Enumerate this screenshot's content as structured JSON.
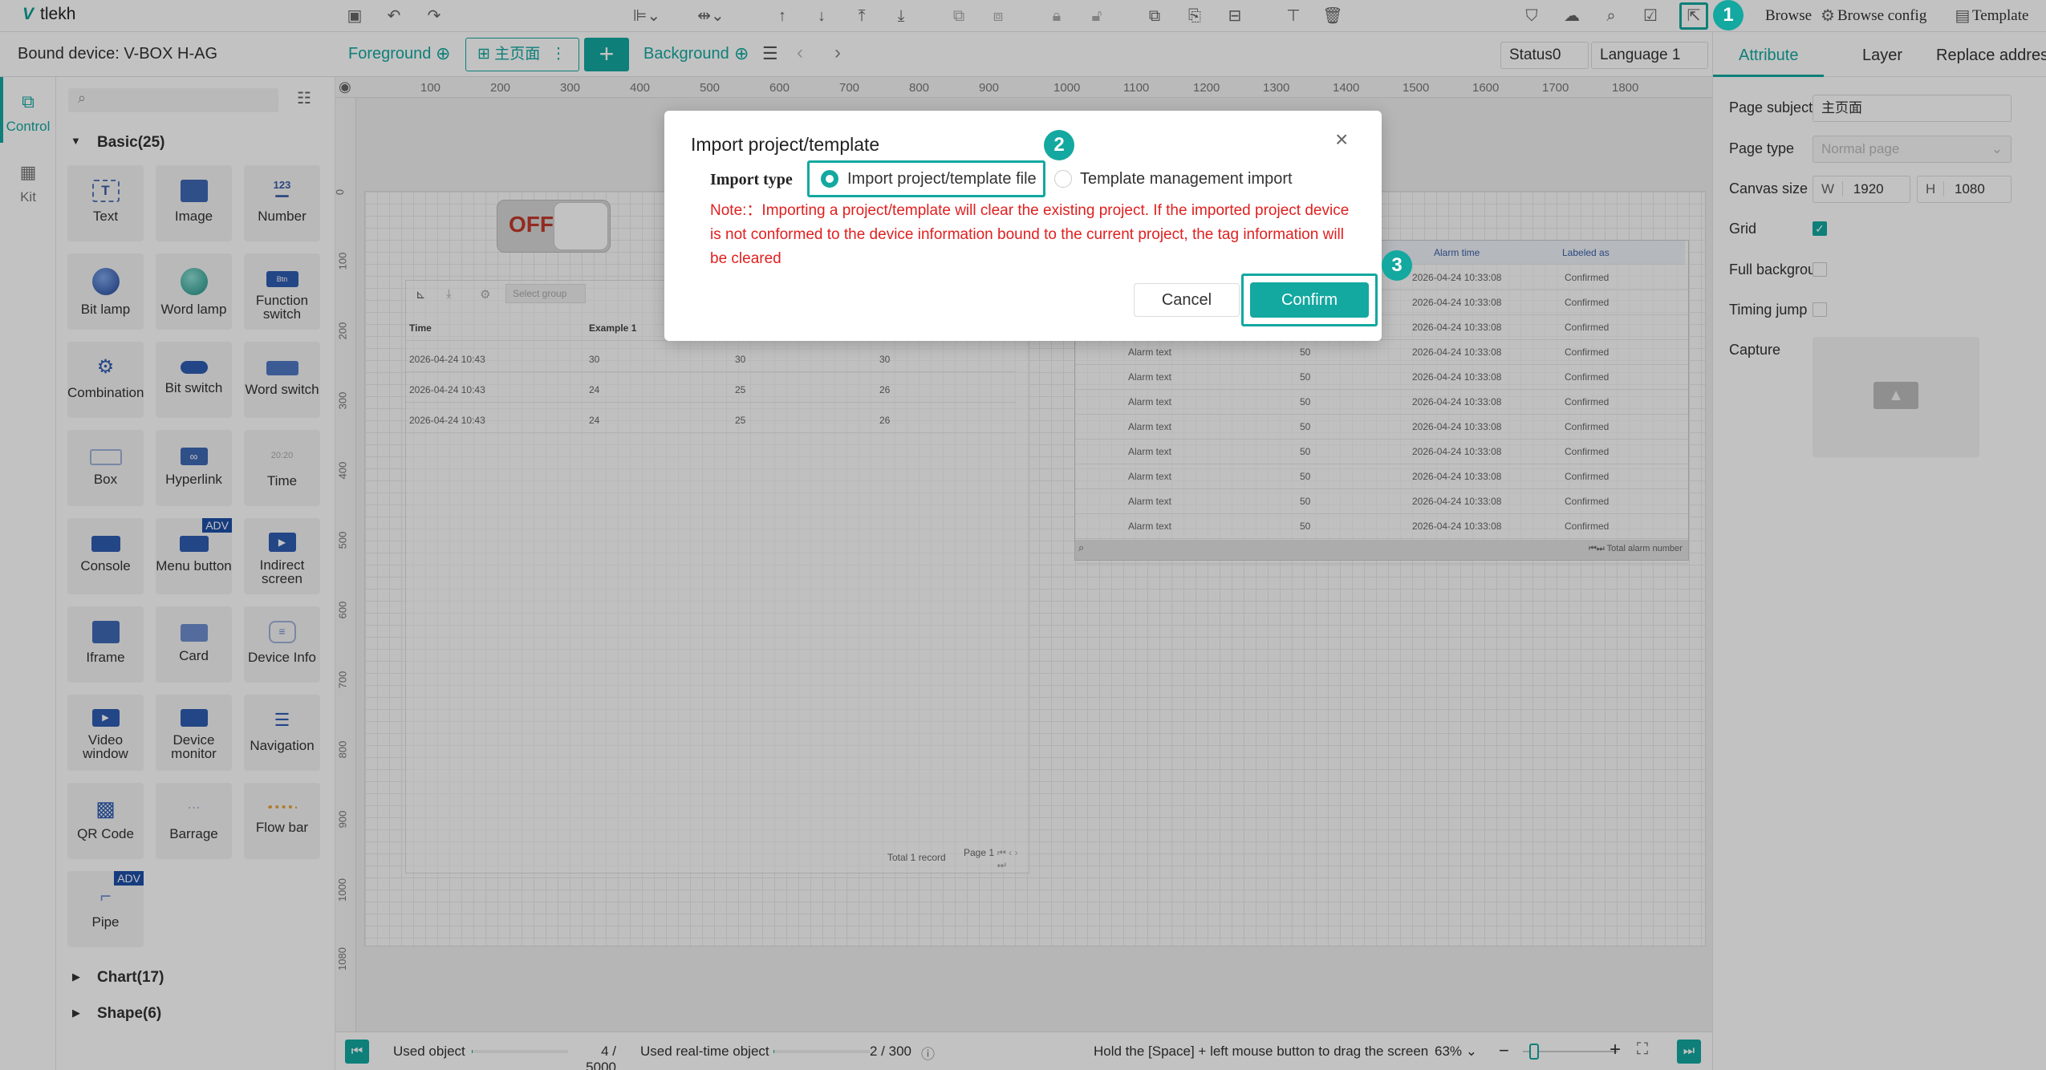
{
  "app": {
    "name": "tlekh"
  },
  "topbar": {
    "browse": "Browse",
    "browse_config": "Browse config",
    "template": "Template"
  },
  "bar2": {
    "device": "Bound device: V-BOX H-AG",
    "foreground": "Foreground",
    "page_tab": "主页面",
    "background": "Background",
    "status": "Status0",
    "language": "Language 1"
  },
  "rail": {
    "control": "Control",
    "kit": "Kit"
  },
  "panel": {
    "basic_header": "Basic(25)",
    "chart_header": "Chart(17)",
    "shape_header": "Shape(6)",
    "items": [
      "Text",
      "Image",
      "Number",
      "Bit lamp",
      "Word lamp",
      "Function switch",
      "Combination",
      "Bit switch",
      "Word switch",
      "Box",
      "Hyperlink",
      "Time",
      "Console",
      "Menu button",
      "Indirect screen",
      "Iframe",
      "Card",
      "Device Info",
      "Video window",
      "Device monitor",
      "Navigation",
      "QR Code",
      "Barrage",
      "Flow bar",
      "Pipe"
    ],
    "adv_badge": "ADV"
  },
  "ruler": {
    "h": [
      "100",
      "200",
      "300",
      "400",
      "500",
      "600",
      "700",
      "800",
      "900",
      "1000",
      "1100",
      "1200",
      "1300",
      "1400",
      "1500",
      "1600",
      "1700",
      "1800"
    ],
    "v": [
      "0",
      "100",
      "200",
      "300",
      "400",
      "500",
      "600",
      "700",
      "800",
      "900",
      "1000",
      "1080"
    ]
  },
  "canvas": {
    "toggle": "OFF",
    "left_table": {
      "select_group": "Select group",
      "headers": [
        "Time",
        "Example 1"
      ],
      "rows": [
        [
          "2026-04-24 10:43",
          "30",
          "30",
          "30"
        ],
        [
          "2026-04-24 10:43",
          "24",
          "25",
          "26"
        ],
        [
          "2026-04-24 10:43",
          "24",
          "25",
          "26"
        ]
      ],
      "footer_total": "Total 1 record",
      "footer_page": "Page 1"
    },
    "alarm_table": {
      "headers": [
        "Alarm time",
        "Labeled as"
      ],
      "col_text": "Alarm text",
      "col_value": "50",
      "col_time": "2026-04-24 10:33:08",
      "col_status": "Confirmed",
      "footer": "Total alarm number"
    }
  },
  "right_panel": {
    "tabs": [
      "Attribute",
      "Layer",
      "Replace address"
    ],
    "page_subject_label": "Page subject",
    "page_subject_value": "主页面",
    "page_type_label": "Page type",
    "page_type_value": "Normal page",
    "canvas_size_label": "Canvas size",
    "w_label": "W",
    "w_value": "1920",
    "h_label": "H",
    "h_value": "1080",
    "grid_label": "Grid",
    "full_bg_label": "Full backgroun",
    "timing_jump_label": "Timing jump",
    "capture_label": "Capture"
  },
  "status_bar": {
    "used_object_label": "Used object",
    "used_object_value": "4 / 5000",
    "used_object_fraction": 0.0008,
    "used_realtime_label": "Used real-time object",
    "used_realtime_value": "2 / 300",
    "used_realtime_fraction": 0.0067,
    "hint": "Hold the [Space] + left mouse button to drag the screen",
    "zoom": "63%"
  },
  "dialog": {
    "title": "Import project/template",
    "import_type_label": "Import type",
    "option1": "Import project/template file",
    "option2": "Template management import",
    "note": "Note:：Importing a project/template will clear the existing project. If the imported project device is not conformed to the device information bound to the current project, the tag information will be cleared",
    "cancel": "Cancel",
    "confirm": "Confirm"
  },
  "steps": [
    "1",
    "2",
    "3"
  ],
  "colors": {
    "accent": "#13a8a0",
    "note_red": "#e02020",
    "overlay": "rgba(0,0,0,0.24)"
  }
}
